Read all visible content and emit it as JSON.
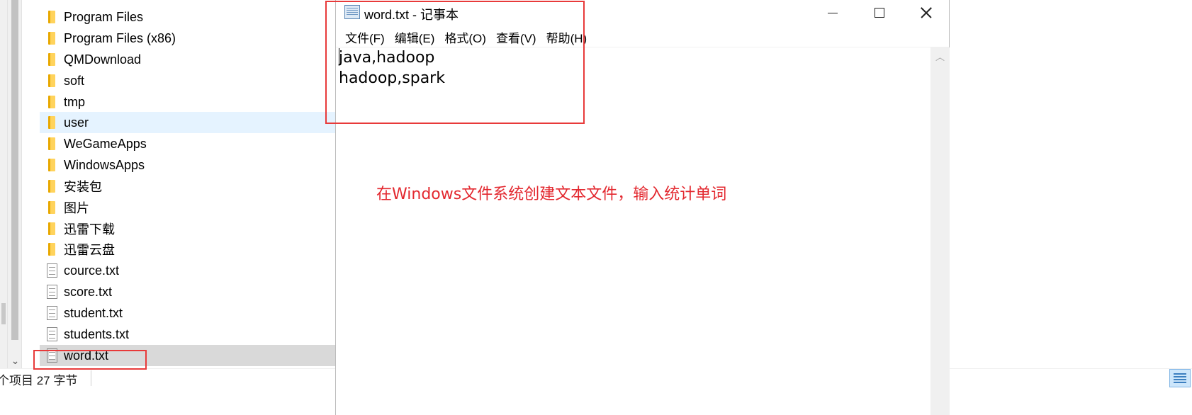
{
  "explorer": {
    "files": [
      {
        "name": "Program Files",
        "type": "folder",
        "icon": "folder-icon"
      },
      {
        "name": "Program Files (x86)",
        "type": "folder",
        "icon": "folder-icon"
      },
      {
        "name": "QMDownload",
        "type": "folder",
        "icon": "folder-icon"
      },
      {
        "name": "soft",
        "type": "folder",
        "icon": "folder-icon"
      },
      {
        "name": "tmp",
        "type": "folder",
        "icon": "folder-icon"
      },
      {
        "name": "user",
        "type": "folder",
        "icon": "folder-icon",
        "state": "hover"
      },
      {
        "name": "WeGameApps",
        "type": "folder",
        "icon": "folder-icon"
      },
      {
        "name": "WindowsApps",
        "type": "folder",
        "icon": "folder-icon"
      },
      {
        "name": "安装包",
        "type": "folder",
        "icon": "folder-icon"
      },
      {
        "name": "图片",
        "type": "folder",
        "icon": "folder-icon"
      },
      {
        "name": "迅雷下载",
        "type": "folder",
        "icon": "folder-icon"
      },
      {
        "name": "迅雷云盘",
        "type": "folder",
        "icon": "folder-icon"
      },
      {
        "name": "cource.txt",
        "type": "file",
        "icon": "text-file-icon"
      },
      {
        "name": "score.txt",
        "type": "file",
        "icon": "text-file-icon"
      },
      {
        "name": "student.txt",
        "type": "file",
        "icon": "text-file-icon"
      },
      {
        "name": "students.txt",
        "type": "file",
        "icon": "text-file-icon"
      },
      {
        "name": "word.txt",
        "type": "file",
        "icon": "text-file-icon",
        "state": "selected"
      }
    ],
    "status": {
      "text": "个项目  27 字节"
    }
  },
  "notepad": {
    "title": "word.txt - 记事本",
    "menu": [
      "文件(F)",
      "编辑(E)",
      "格式(O)",
      "查看(V)",
      "帮助(H)"
    ],
    "content_lines": [
      "java,hadoop",
      "hadoop,spark"
    ]
  },
  "annotation": {
    "text": "在Windows文件系统创建文本文件，输入统计单词",
    "color": "#e3282f"
  },
  "colors": {
    "hover_row": "#e5f3ff",
    "selected_row": "#d9d9d9",
    "highlight_box": "#e83a3a"
  }
}
